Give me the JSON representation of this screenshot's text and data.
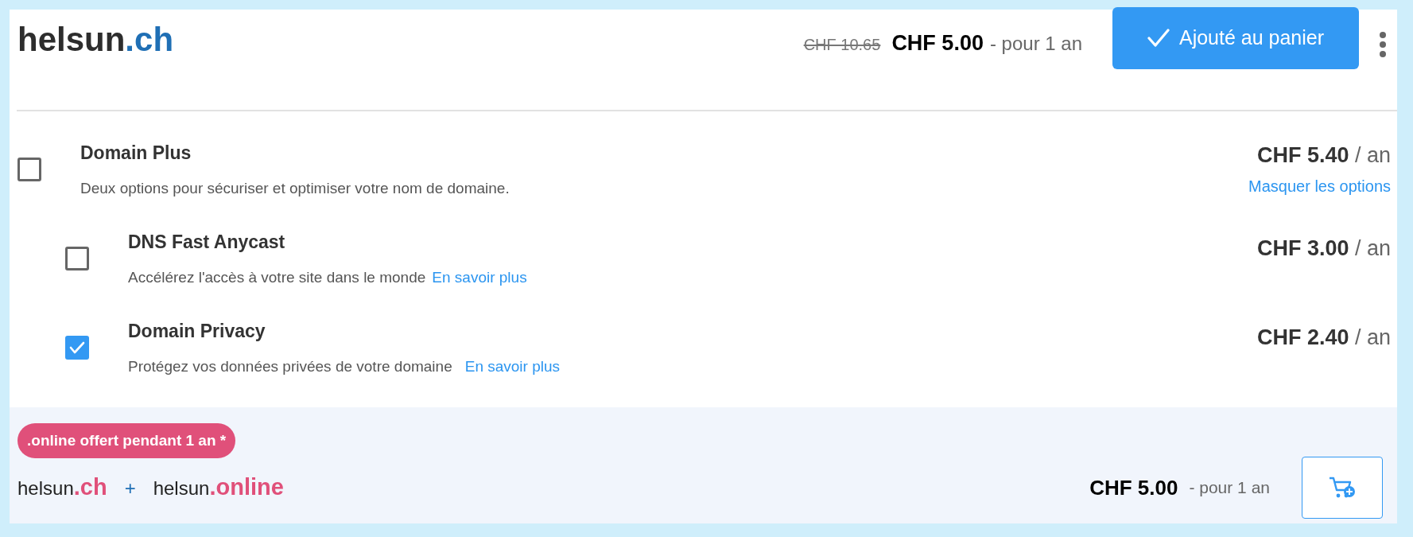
{
  "domain": {
    "name": "helsun",
    "tld": ".ch"
  },
  "pricing": {
    "old_price": "CHF 10.65",
    "price": "CHF 5.00",
    "period": "- pour 1 an"
  },
  "cart_button": {
    "label": "Ajouté au panier",
    "added": true
  },
  "options": [
    {
      "title": "Domain Plus",
      "description": "Deux options pour sécuriser et optimiser votre nom de domaine.",
      "price": "CHF 5.40",
      "unit": "/ an",
      "toggle_link": "Masquer les options",
      "checked": false,
      "children": [
        {
          "title": "DNS Fast Anycast",
          "description": "Accélérez l'accès à votre site dans le monde",
          "link": "En savoir plus",
          "price": "CHF 3.00",
          "unit": "/ an",
          "checked": false
        },
        {
          "title": "Domain Privacy",
          "description": "Protégez vos données privées de votre domaine",
          "link": "En savoir plus",
          "price": "CHF 2.40",
          "unit": "/ an",
          "checked": true
        }
      ]
    }
  ],
  "bundle": {
    "badge": ".online offert pendant 1 an *",
    "domains": [
      {
        "name": "helsun",
        "tld": ".ch"
      },
      {
        "name": "helsun",
        "tld": ".online"
      }
    ],
    "separator": "+",
    "price": "CHF 5.00",
    "period": "- pour 1 an"
  }
}
